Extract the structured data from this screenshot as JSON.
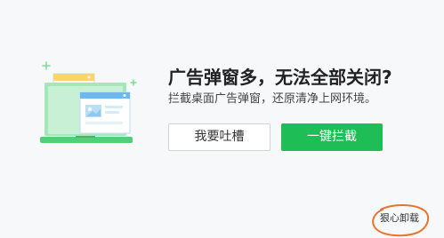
{
  "dialog": {
    "headline": "广告弹窗多，无法全部关闭?",
    "subtitle": "拦截桌面广告弹窗，还原清净上网环境。",
    "complain_button": "我要吐槽",
    "block_button": "一键拦截",
    "uninstall_link": "狠心卸载"
  },
  "colors": {
    "accent_green": "#1fbd55",
    "annotation_orange": "#e8742a",
    "background": "#f7f8fa"
  },
  "icons": [
    "sparkle-icon",
    "desktop-popup-illustration"
  ]
}
